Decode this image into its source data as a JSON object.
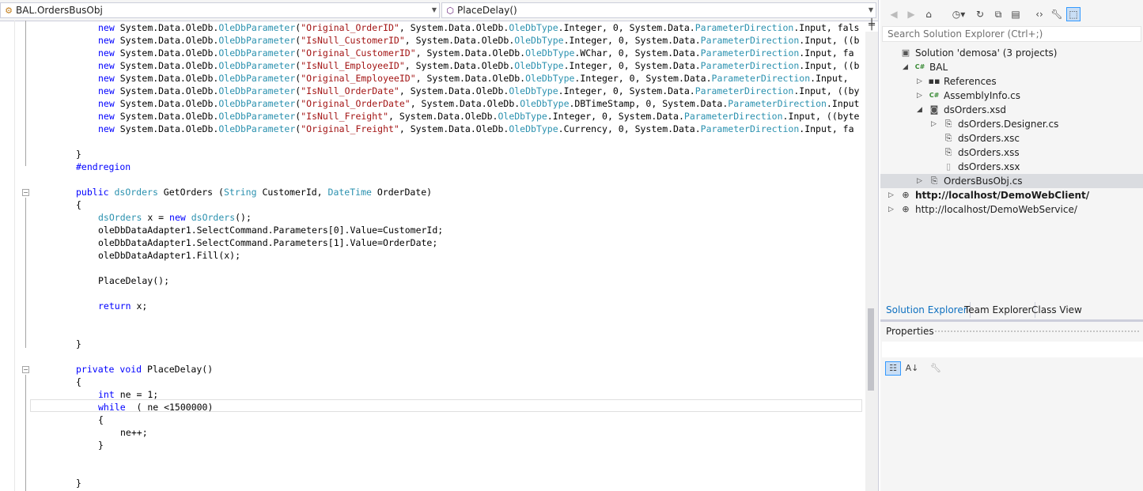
{
  "editor": {
    "nav_class": "BAL.OrdersBusObj",
    "nav_member": "PlaceDelay()",
    "code_lines": [
      {
        "line": 0,
        "indent": 4,
        "tokens": [
          [
            "kw",
            "new"
          ],
          [
            "n",
            " System.Data.OleDb."
          ],
          [
            "ty",
            "OleDbParameter"
          ],
          [
            "n",
            "("
          ],
          [
            "st",
            "\"Original_OrderID\""
          ],
          [
            "n",
            ", System.Data.OleDb."
          ],
          [
            "ty",
            "OleDbType"
          ],
          [
            "n",
            ".Integer, 0, System.Data."
          ],
          [
            "ty",
            "ParameterDirection"
          ],
          [
            "n",
            ".Input, fals"
          ]
        ]
      },
      {
        "line": 1,
        "indent": 4,
        "tokens": [
          [
            "kw",
            "new"
          ],
          [
            "n",
            " System.Data.OleDb."
          ],
          [
            "ty",
            "OleDbParameter"
          ],
          [
            "n",
            "("
          ],
          [
            "st",
            "\"IsNull_CustomerID\""
          ],
          [
            "n",
            ", System.Data.OleDb."
          ],
          [
            "ty",
            "OleDbType"
          ],
          [
            "n",
            ".Integer, 0, System.Data."
          ],
          [
            "ty",
            "ParameterDirection"
          ],
          [
            "n",
            ".Input, ((b"
          ]
        ]
      },
      {
        "line": 2,
        "indent": 4,
        "tokens": [
          [
            "kw",
            "new"
          ],
          [
            "n",
            " System.Data.OleDb."
          ],
          [
            "ty",
            "OleDbParameter"
          ],
          [
            "n",
            "("
          ],
          [
            "st",
            "\"Original_CustomerID\""
          ],
          [
            "n",
            ", System.Data.OleDb."
          ],
          [
            "ty",
            "OleDbType"
          ],
          [
            "n",
            ".WChar, 0, System.Data."
          ],
          [
            "ty",
            "ParameterDirection"
          ],
          [
            "n",
            ".Input, fa"
          ]
        ]
      },
      {
        "line": 3,
        "indent": 4,
        "tokens": [
          [
            "kw",
            "new"
          ],
          [
            "n",
            " System.Data.OleDb."
          ],
          [
            "ty",
            "OleDbParameter"
          ],
          [
            "n",
            "("
          ],
          [
            "st",
            "\"IsNull_EmployeeID\""
          ],
          [
            "n",
            ", System.Data.OleDb."
          ],
          [
            "ty",
            "OleDbType"
          ],
          [
            "n",
            ".Integer, 0, System.Data."
          ],
          [
            "ty",
            "ParameterDirection"
          ],
          [
            "n",
            ".Input, ((b"
          ]
        ]
      },
      {
        "line": 4,
        "indent": 4,
        "tokens": [
          [
            "kw",
            "new"
          ],
          [
            "n",
            " System.Data.OleDb."
          ],
          [
            "ty",
            "OleDbParameter"
          ],
          [
            "n",
            "("
          ],
          [
            "st",
            "\"Original_EmployeeID\""
          ],
          [
            "n",
            ", System.Data.OleDb."
          ],
          [
            "ty",
            "OleDbType"
          ],
          [
            "n",
            ".Integer, 0, System.Data."
          ],
          [
            "ty",
            "ParameterDirection"
          ],
          [
            "n",
            ".Input, "
          ]
        ]
      },
      {
        "line": 5,
        "indent": 4,
        "tokens": [
          [
            "kw",
            "new"
          ],
          [
            "n",
            " System.Data.OleDb."
          ],
          [
            "ty",
            "OleDbParameter"
          ],
          [
            "n",
            "("
          ],
          [
            "st",
            "\"IsNull_OrderDate\""
          ],
          [
            "n",
            ", System.Data.OleDb."
          ],
          [
            "ty",
            "OleDbType"
          ],
          [
            "n",
            ".Integer, 0, System.Data."
          ],
          [
            "ty",
            "ParameterDirection"
          ],
          [
            "n",
            ".Input, ((by"
          ]
        ]
      },
      {
        "line": 6,
        "indent": 4,
        "tokens": [
          [
            "kw",
            "new"
          ],
          [
            "n",
            " System.Data.OleDb."
          ],
          [
            "ty",
            "OleDbParameter"
          ],
          [
            "n",
            "("
          ],
          [
            "st",
            "\"Original_OrderDate\""
          ],
          [
            "n",
            ", System.Data.OleDb."
          ],
          [
            "ty",
            "OleDbType"
          ],
          [
            "n",
            ".DBTimeStamp, 0, System.Data."
          ],
          [
            "ty",
            "ParameterDirection"
          ],
          [
            "n",
            ".Input"
          ]
        ]
      },
      {
        "line": 7,
        "indent": 4,
        "tokens": [
          [
            "kw",
            "new"
          ],
          [
            "n",
            " System.Data.OleDb."
          ],
          [
            "ty",
            "OleDbParameter"
          ],
          [
            "n",
            "("
          ],
          [
            "st",
            "\"IsNull_Freight\""
          ],
          [
            "n",
            ", System.Data.OleDb."
          ],
          [
            "ty",
            "OleDbType"
          ],
          [
            "n",
            ".Integer, 0, System.Data."
          ],
          [
            "ty",
            "ParameterDirection"
          ],
          [
            "n",
            ".Input, ((byte"
          ]
        ]
      },
      {
        "line": 8,
        "indent": 4,
        "tokens": [
          [
            "kw",
            "new"
          ],
          [
            "n",
            " System.Data.OleDb."
          ],
          [
            "ty",
            "OleDbParameter"
          ],
          [
            "n",
            "("
          ],
          [
            "st",
            "\"Original_Freight\""
          ],
          [
            "n",
            ", System.Data.OleDb."
          ],
          [
            "ty",
            "OleDbType"
          ],
          [
            "n",
            ".Currency, 0, System.Data."
          ],
          [
            "ty",
            "ParameterDirection"
          ],
          [
            "n",
            ".Input, fa"
          ]
        ]
      },
      {
        "line": 10,
        "indent": 3,
        "tokens": [
          [
            "n",
            "}"
          ]
        ]
      },
      {
        "line": 11,
        "indent": 3,
        "tokens": [
          [
            "kw",
            "#endregion"
          ]
        ]
      },
      {
        "line": 13,
        "indent": 3,
        "tokens": [
          [
            "kw",
            "public"
          ],
          [
            "n",
            " "
          ],
          [
            "ty",
            "dsOrders"
          ],
          [
            "n",
            " GetOrders ("
          ],
          [
            "ty",
            "String"
          ],
          [
            "n",
            " CustomerId, "
          ],
          [
            "ty",
            "DateTime"
          ],
          [
            "n",
            " OrderDate)"
          ]
        ]
      },
      {
        "line": 14,
        "indent": 3,
        "tokens": [
          [
            "n",
            "{"
          ]
        ]
      },
      {
        "line": 15,
        "indent": 4,
        "tokens": [
          [
            "ty",
            "dsOrders"
          ],
          [
            "n",
            " x = "
          ],
          [
            "kw",
            "new"
          ],
          [
            "n",
            " "
          ],
          [
            "ty",
            "dsOrders"
          ],
          [
            "n",
            "();"
          ]
        ]
      },
      {
        "line": 16,
        "indent": 4,
        "tokens": [
          [
            "n",
            "oleDbDataAdapter1.SelectCommand.Parameters[0].Value=CustomerId;"
          ]
        ]
      },
      {
        "line": 17,
        "indent": 4,
        "tokens": [
          [
            "n",
            "oleDbDataAdapter1.SelectCommand.Parameters[1].Value=OrderDate;"
          ]
        ]
      },
      {
        "line": 18,
        "indent": 4,
        "tokens": [
          [
            "n",
            "oleDbDataAdapter1.Fill(x);"
          ]
        ]
      },
      {
        "line": 20,
        "indent": 4,
        "tokens": [
          [
            "n",
            "PlaceDelay();"
          ]
        ]
      },
      {
        "line": 22,
        "indent": 4,
        "tokens": [
          [
            "kw",
            "return"
          ],
          [
            "n",
            " x;"
          ]
        ]
      },
      {
        "line": 25,
        "indent": 3,
        "tokens": [
          [
            "n",
            "}"
          ]
        ]
      },
      {
        "line": 27,
        "indent": 3,
        "tokens": [
          [
            "kw",
            "private"
          ],
          [
            "n",
            " "
          ],
          [
            "kw",
            "void"
          ],
          [
            "n",
            " PlaceDelay()"
          ]
        ]
      },
      {
        "line": 28,
        "indent": 3,
        "tokens": [
          [
            "n",
            "{"
          ]
        ]
      },
      {
        "line": 29,
        "indent": 4,
        "tokens": [
          [
            "kw",
            "int"
          ],
          [
            "n",
            " ne = 1;"
          ]
        ]
      },
      {
        "line": 30,
        "indent": 4,
        "tokens": [
          [
            "kw",
            "while"
          ],
          [
            "n",
            "  ( ne <1500000)"
          ]
        ]
      },
      {
        "line": 31,
        "indent": 4,
        "tokens": [
          [
            "n",
            "{"
          ]
        ]
      },
      {
        "line": 32,
        "indent": 5,
        "tokens": [
          [
            "n",
            "ne++;"
          ]
        ]
      },
      {
        "line": 33,
        "indent": 4,
        "tokens": [
          [
            "n",
            "}"
          ]
        ]
      },
      {
        "line": 36,
        "indent": 3,
        "tokens": [
          [
            "n",
            "}"
          ]
        ]
      }
    ],
    "fold_lines": [
      13,
      27
    ]
  },
  "solution_explorer": {
    "search_placeholder": "Search Solution Explorer (Ctrl+;)",
    "toolbar_icons": [
      "back-icon",
      "forward-icon",
      "home-icon",
      "history-icon",
      "refresh-icon",
      "collapse-all-icon",
      "show-all-files-icon",
      "view-code-icon",
      "properties-icon",
      "preview-icon"
    ],
    "tree": [
      {
        "label": "Solution 'demosa' (3 projects)",
        "icon": "solution-icon",
        "level": 0,
        "exp": ""
      },
      {
        "label": "BAL",
        "icon": "csharp-project-icon",
        "level": 1,
        "exp": "open",
        "bold": false
      },
      {
        "label": "References",
        "icon": "references-icon",
        "level": 2,
        "exp": "closed"
      },
      {
        "label": "AssemblyInfo.cs",
        "icon": "csharp-file-icon",
        "level": 2,
        "exp": "closed"
      },
      {
        "label": "dsOrders.xsd",
        "icon": "dataset-icon",
        "level": 2,
        "exp": "open"
      },
      {
        "label": "dsOrders.Designer.cs",
        "icon": "code-file-icon",
        "level": 3,
        "exp": "closed"
      },
      {
        "label": "dsOrders.xsc",
        "icon": "code-file-icon",
        "level": 3,
        "exp": ""
      },
      {
        "label": "dsOrders.xss",
        "icon": "code-file-icon",
        "level": 3,
        "exp": ""
      },
      {
        "label": "dsOrders.xsx",
        "icon": "file-icon",
        "level": 3,
        "exp": ""
      },
      {
        "label": "OrdersBusObj.cs",
        "icon": "component-file-icon",
        "level": 2,
        "exp": "closed",
        "selected": true
      },
      {
        "label": "http://localhost/DemoWebClient/",
        "icon": "globe-icon",
        "level": 0,
        "exp": "closed",
        "bold": true
      },
      {
        "label": "http://localhost/DemoWebService/",
        "icon": "globe-icon",
        "level": 0,
        "exp": "closed"
      }
    ],
    "tabs": [
      "Solution Explorer",
      "Team Explorer",
      "Class View"
    ],
    "active_tab": 0
  },
  "properties": {
    "title": "Properties",
    "toolbar_icons": [
      "categorized-icon",
      "alphabetical-icon",
      "property-pages-icon"
    ]
  },
  "colors": {
    "keyword": "#0000ff",
    "type": "#2b91af",
    "string": "#a31515",
    "accent": "#0e70c0"
  }
}
